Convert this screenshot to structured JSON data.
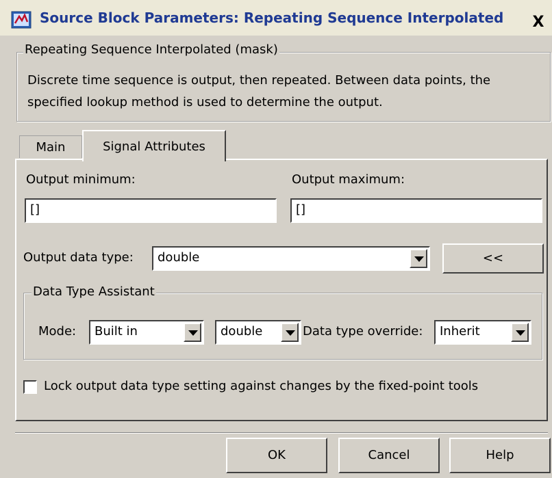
{
  "window": {
    "title": "Source Block Parameters: Repeating Sequence Interpolated",
    "close_label": "X"
  },
  "mask": {
    "group_label": "Repeating Sequence Interpolated (mask)",
    "description": "Discrete time sequence is output, then repeated.  Between data points, the specified lookup method is used to determine the output."
  },
  "tabs": [
    {
      "label": "Main",
      "active": false
    },
    {
      "label": "Signal Attributes",
      "active": true
    }
  ],
  "signal_attributes": {
    "output_min_label": "Output minimum:",
    "output_min_value": "[]",
    "output_max_label": "Output maximum:",
    "output_max_value": "[]",
    "output_data_type_label": "Output data type:",
    "output_data_type_value": "double",
    "assistant_toggle_label": "<<",
    "assistant": {
      "group_label": "Data Type Assistant",
      "mode_label": "Mode:",
      "mode_value": "Built in",
      "builtin_type_value": "double",
      "override_label": "Data type override:",
      "override_value": "Inherit"
    },
    "lock_label": "Lock output data type setting against changes by the fixed-point tools",
    "lock_checked": false
  },
  "buttons": {
    "ok": "OK",
    "cancel": "Cancel",
    "help": "Help"
  },
  "colors": {
    "title_text": "#1f3a93",
    "dialog_bg": "#d4d0c8"
  }
}
